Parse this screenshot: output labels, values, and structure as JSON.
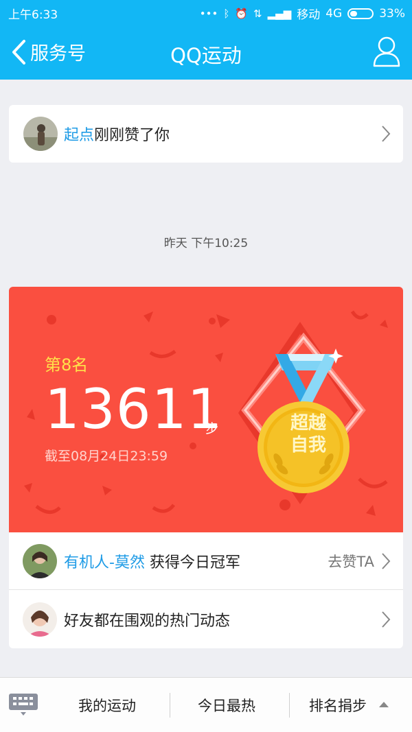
{
  "status_bar": {
    "time": "上午6:33",
    "carrier": "移动",
    "network": "4G",
    "battery": "33%"
  },
  "header": {
    "back_label": "服务号",
    "title": "QQ运动"
  },
  "like_notification": {
    "user": "起点",
    "message": "刚刚赞了你"
  },
  "timestamp": "昨天 下午10:25",
  "rank_card": {
    "rank": "第8名",
    "steps": "13611",
    "unit": "步",
    "deadline": "截至08月24日23:59",
    "medal_text_line1": "超越",
    "medal_text_line2": "自我"
  },
  "champion_row": {
    "user": "有机人-莫然",
    "message": "获得今日冠军",
    "action": "去赞TA"
  },
  "hot_row": {
    "message": "好友都在围观的热门动态"
  },
  "bottom_tabs": [
    "我的运动",
    "今日最热",
    "排名捐步"
  ],
  "colors": {
    "header_blue": "#12b7f5",
    "card_red": "#fa4f40",
    "rank_yellow": "#ffe24a",
    "link_blue": "#1e9be6"
  }
}
